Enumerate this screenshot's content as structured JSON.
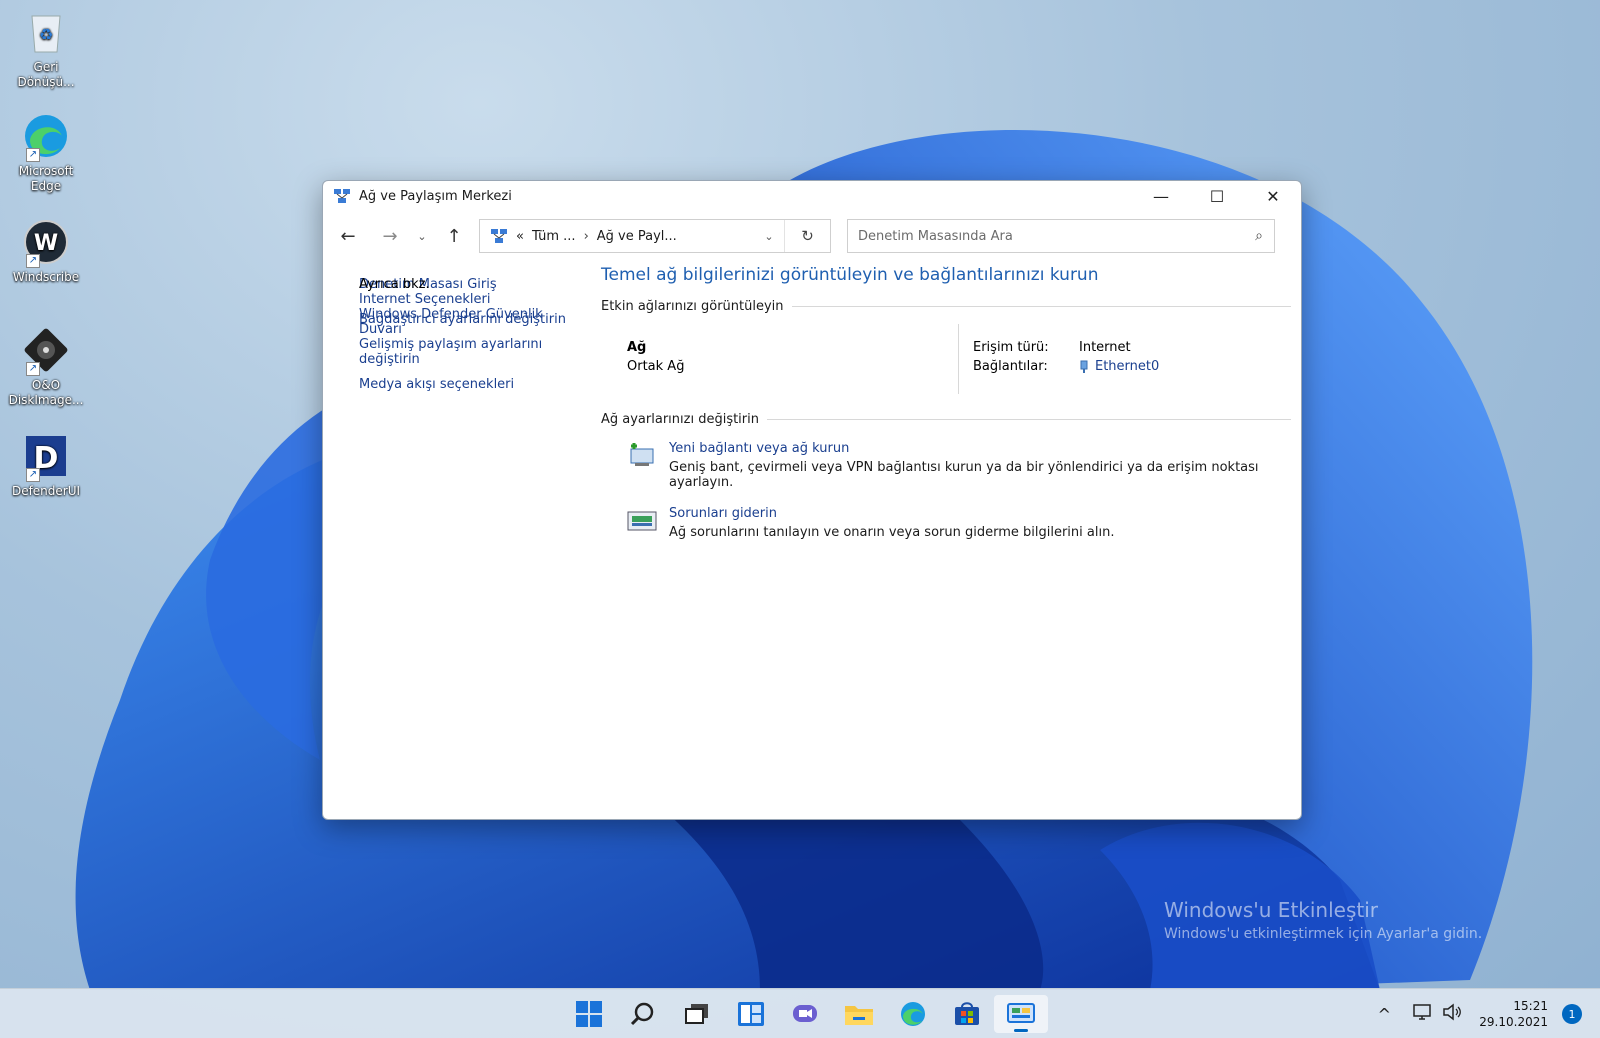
{
  "desktop": {
    "icons": [
      {
        "label": "Geri Dönüşü...",
        "icon": "recycle-bin-icon"
      },
      {
        "label": "Microsoft Edge",
        "icon": "edge-icon"
      },
      {
        "label": "Windscribe",
        "icon": "windscribe-icon"
      },
      {
        "label": "O&O DiskImage...",
        "icon": "diskimage-icon"
      },
      {
        "label": "DefenderUI",
        "icon": "defenderui-icon"
      }
    ],
    "watermark": {
      "line1": "Windows'u Etkinleştir",
      "line2": "Windows'u etkinleştirmek için Ayarlar'a gidin."
    }
  },
  "window": {
    "title": "Ağ ve Paylaşım Merkezi",
    "controls": {
      "minimize": "—",
      "maximize": "☐",
      "close": "✕"
    },
    "toolbar": {
      "address": {
        "prefix": "«",
        "crumb1": "Tüm ...",
        "separator": "›",
        "crumb2": "Ağ ve Payl..."
      },
      "search_placeholder": "Denetim Masasında Ara"
    },
    "sidebar": {
      "home": "Denetim Masası Giriş",
      "items": [
        "Bağdaştırıcı ayarlarını değiştirin",
        "Gelişmiş paylaşım ayarlarını değiştirin",
        "Medya akışı seçenekleri"
      ],
      "see_also": {
        "heading": "Ayrıca bkz.",
        "links": [
          "Internet Seçenekleri",
          "Windows Defender Güvenlik Duvarı"
        ]
      }
    },
    "main": {
      "heading": "Temel ağ bilgilerinizi görüntüleyin ve bağlantılarınızı kurun",
      "active_networks": {
        "section_title": "Etkin ağlarınızı görüntüleyin",
        "network_name": "Ağ",
        "network_type": "Ortak Ağ",
        "access_type_label": "Erişim türü:",
        "access_type_value": "Internet",
        "connections_label": "Bağlantılar:",
        "connections_value": "Ethernet0"
      },
      "change_settings": {
        "section_title": "Ağ ayarlarınızı değiştirin",
        "tasks": [
          {
            "title": "Yeni bağlantı veya ağ kurun",
            "description": "Geniş bant, çevirmeli veya VPN bağlantısı kurun ya da bir yönlendirici ya da erişim noktası ayarlayın."
          },
          {
            "title": "Sorunları giderin",
            "description": "Ağ sorunlarını tanılayın ve onarın veya sorun giderme bilgilerini alın."
          }
        ]
      }
    }
  },
  "taskbar": {
    "apps": [
      "start-icon",
      "search-icon",
      "task-view-icon",
      "widgets-icon",
      "chat-icon",
      "file-explorer-icon",
      "edge-icon",
      "store-icon",
      "control-panel-icon"
    ],
    "active_app": "control-panel-icon",
    "tray": {
      "chevron": "^",
      "time": "15:21",
      "date": "29.10.2021",
      "notifications": "1"
    }
  },
  "colors": {
    "link": "#1a3f8f",
    "heading": "#1f5fb0",
    "accent": "#0067c0"
  }
}
